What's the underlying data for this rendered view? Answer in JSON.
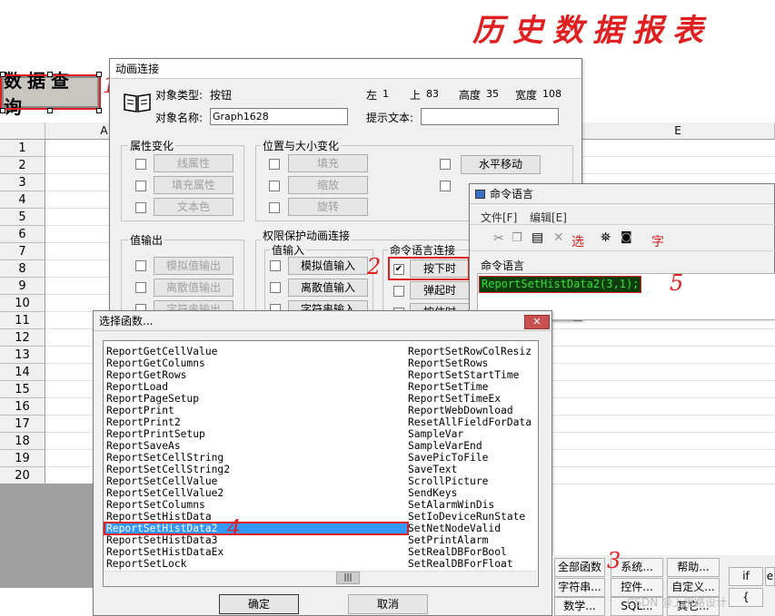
{
  "heading": "历史数据报表",
  "query_button": "数据查询",
  "annotations": [
    "1",
    "2",
    "3",
    "4",
    "5"
  ],
  "sheet": {
    "columns": [
      "A",
      "E"
    ],
    "rows": [
      "1",
      "2",
      "3",
      "4",
      "5",
      "6",
      "7",
      "8",
      "9",
      "10",
      "11",
      "12",
      "13",
      "14",
      "15",
      "16",
      "17",
      "18",
      "19",
      "20"
    ]
  },
  "anim_dialog": {
    "title": "动画连接",
    "object_type_label": "对象类型:",
    "object_type_value": "按钮",
    "left_label": "左",
    "left_value": "1",
    "top_label": "上",
    "top_value": "83",
    "height_label": "高度",
    "height_value": "35",
    "width_label": "宽度",
    "width_value": "108",
    "name_label": "对象名称:",
    "name_value": "Graph1628",
    "tip_label": "提示文本:",
    "tip_value": "",
    "attr_group": "属性变化",
    "attr_buttons": [
      "线属性",
      "填充属性",
      "文本色"
    ],
    "pos_group": "位置与大小变化",
    "pos_buttons": [
      "填充",
      "缩放",
      "旋转"
    ],
    "hmove_button": "水平移动",
    "value_out_group": "值输出",
    "value_out_buttons": [
      "模拟值输出",
      "离散值输出",
      "字符串输出"
    ],
    "perm_group": "权限保护动画连接",
    "value_in_group": "值输入",
    "value_in_buttons": [
      "模拟值输入",
      "离散值输入",
      "字符串输入"
    ],
    "cmd_group": "命令语言连接",
    "cmd_buttons": [
      "按下时",
      "弹起时",
      "按住时"
    ]
  },
  "cmd_window": {
    "title": "命令语言",
    "menu": [
      "文件[F]",
      "编辑[E]"
    ],
    "toolbar_select": "选",
    "toolbar_font": "字",
    "section_label": "命令语言",
    "code": "ReportSetHistData2(3,1);"
  },
  "func_dialog": {
    "title": "选择函数...",
    "left_items": [
      "ReportGetCellValue",
      "ReportGetColumns",
      "ReportGetRows",
      "ReportLoad",
      "ReportPageSetup",
      "ReportPrint",
      "ReportPrint2",
      "ReportPrintSetup",
      "ReportSaveAs",
      "ReportSetCellString",
      "ReportSetCellString2",
      "ReportSetCellValue",
      "ReportSetCellValue2",
      "ReportSetColumns",
      "ReportSetHistData",
      "ReportSetHistData2",
      "ReportSetHistData3",
      "ReportSetHistDataEx",
      "ReportSetLock"
    ],
    "right_items": [
      "ReportSetRowColResiz",
      "ReportSetRows",
      "ReportSetStartTime",
      "ReportSetTime",
      "ReportSetTimeEx",
      "ReportWebDownload",
      "ResetAllFieldForData",
      "SampleVar",
      "SampleVarEnd",
      "SavePicToFile",
      "SaveText",
      "ScrollPicture",
      "SendKeys",
      "SetAlarmWinDis",
      "SetIoDeviceRunState",
      "SetNetNodeValid",
      "SetPrintAlarm",
      "SetRealDBForBool",
      "SetRealDBForFloat"
    ],
    "selected": "ReportSetHistData2",
    "scroll_glyph": "|||",
    "ok": "确定",
    "cancel": "取消"
  },
  "palette": {
    "buttons": [
      "全部函数",
      "系统...",
      "帮助...",
      "字符串...",
      "控件...",
      "自定义...",
      "数学...",
      "SQL...",
      "其它..."
    ],
    "side": [
      "if",
      "e",
      "{"
    ]
  },
  "watermark": "CSDN @上用路设计"
}
